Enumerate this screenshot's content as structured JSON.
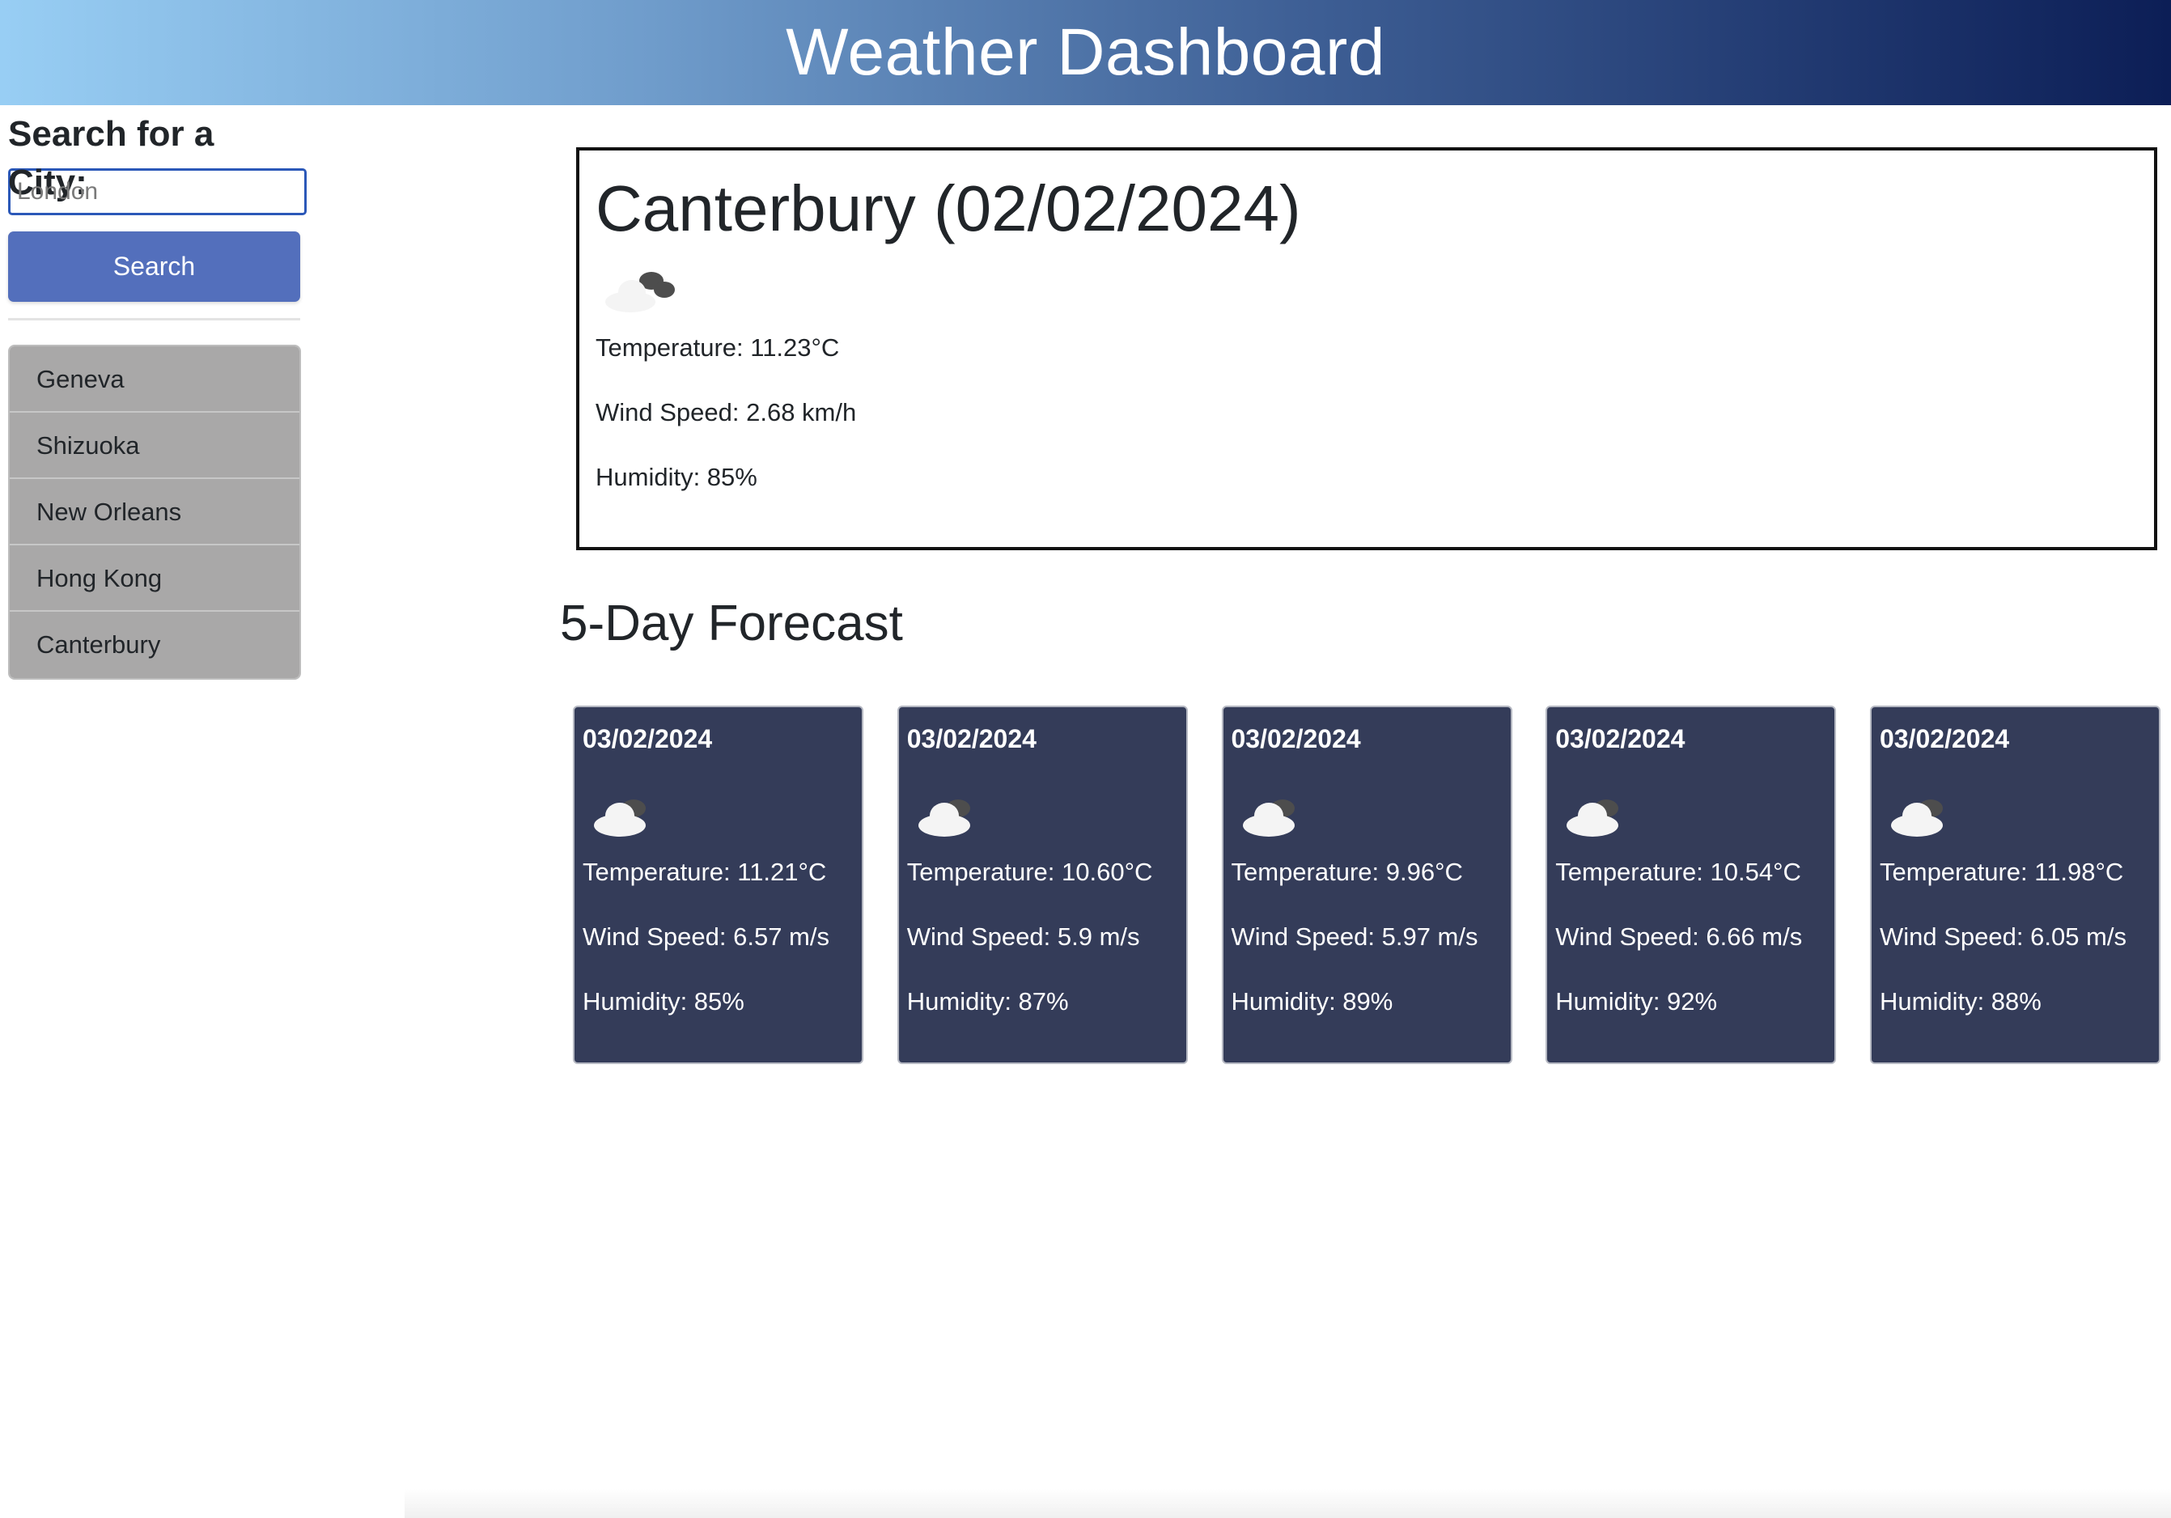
{
  "header": {
    "title": "Weather Dashboard"
  },
  "sidebar": {
    "search_title": "Search for a City:",
    "search_placeholder": "London",
    "search_value": "",
    "search_button": "Search",
    "history": [
      "Geneva",
      "Shizuoka",
      "New Orleans",
      "Hong Kong",
      "Canterbury"
    ]
  },
  "current": {
    "title": "Canterbury (02/02/2024)",
    "icon": "cloud-icon",
    "temperature": "Temperature: 11.23°C",
    "wind": "Wind Speed: 2.68 km/h",
    "humidity": "Humidity: 85%"
  },
  "forecast": {
    "title": "5-Day Forecast",
    "days": [
      {
        "date": "03/02/2024",
        "icon": "cloud-icon",
        "temperature": "Temperature: 11.21°C",
        "wind": "Wind Speed: 6.57 m/s",
        "humidity": "Humidity: 85%"
      },
      {
        "date": "03/02/2024",
        "icon": "cloud-icon",
        "temperature": "Temperature: 10.60°C",
        "wind": "Wind Speed: 5.9 m/s",
        "humidity": "Humidity: 87%"
      },
      {
        "date": "03/02/2024",
        "icon": "cloud-icon",
        "temperature": "Temperature: 9.96°C",
        "wind": "Wind Speed: 5.97 m/s",
        "humidity": "Humidity: 89%"
      },
      {
        "date": "03/02/2024",
        "icon": "cloud-icon",
        "temperature": "Temperature: 10.54°C",
        "wind": "Wind Speed: 6.66 m/s",
        "humidity": "Humidity: 92%"
      },
      {
        "date": "03/02/2024",
        "icon": "cloud-icon",
        "temperature": "Temperature: 11.98°C",
        "wind": "Wind Speed: 6.05 m/s",
        "humidity": "Humidity: 88%"
      }
    ]
  },
  "colors": {
    "header_gradient_start": "#98cef4",
    "header_gradient_end": "#0c1e56",
    "search_button": "#536fbc",
    "history_item": "#a9a8a8",
    "forecast_card": "#343c59"
  }
}
